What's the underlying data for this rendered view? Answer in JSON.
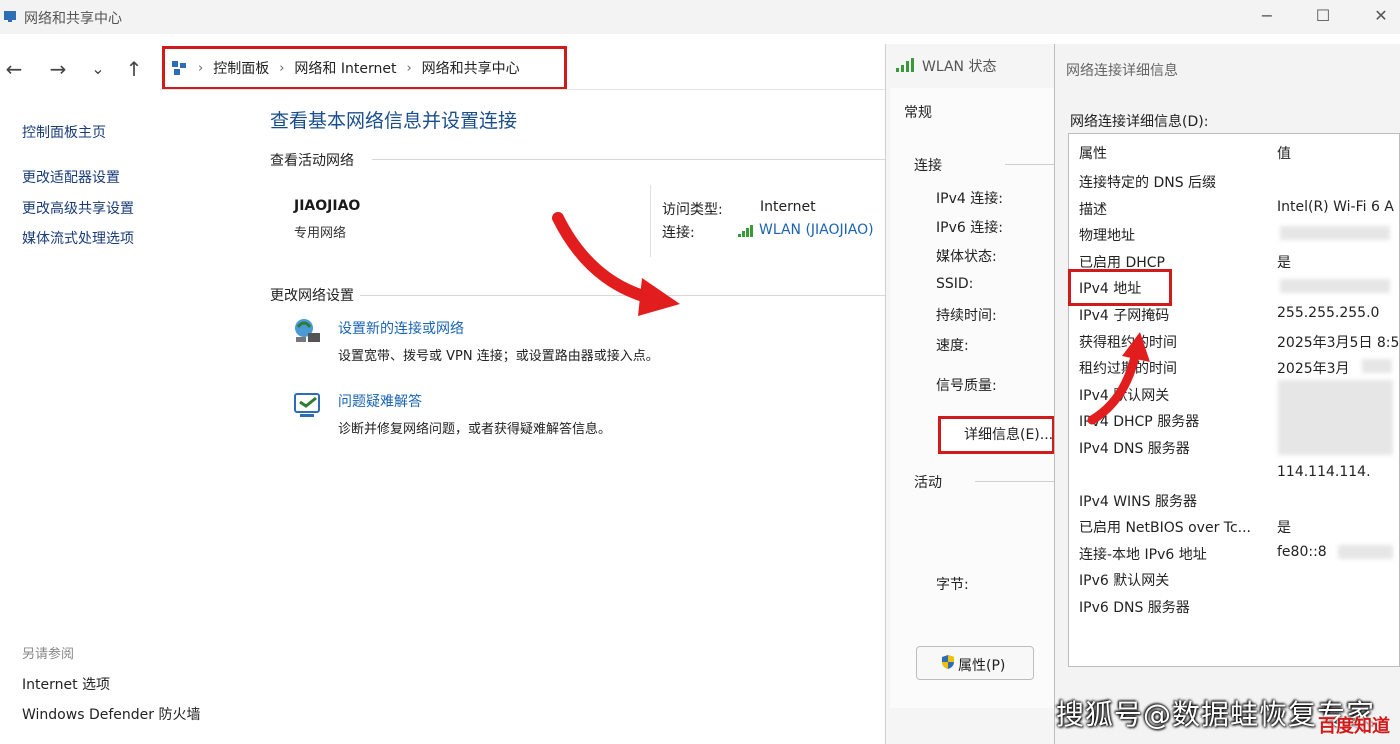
{
  "window": {
    "title": "网络和共享中心",
    "controls": {
      "minimize": "−",
      "maximize": "☐",
      "close": "✕"
    }
  },
  "nav": {
    "back": "←",
    "forward": "→",
    "history": "⌄",
    "up": "↑"
  },
  "breadcrumb": {
    "items": [
      "控制面板",
      "网络和 Internet",
      "网络和共享中心"
    ],
    "separator": "›"
  },
  "sidebar": {
    "home": "控制面板主页",
    "links": [
      "更改适配器设置",
      "更改高级共享设置",
      "媒体流式处理选项"
    ],
    "see_also": "另请参阅",
    "see_also_links": [
      "Internet 选项",
      "Windows Defender 防火墙"
    ]
  },
  "main": {
    "heading": "查看基本网络信息并设置连接",
    "active_networks": "查看活动网络",
    "network_name": "JIAOJIAO",
    "network_type": "专用网络",
    "access_type_label": "访问类型:",
    "access_type_value": "Internet",
    "connection_label": "连接:",
    "connection_value": "WLAN (JIAOJIAO)",
    "change_settings": "更改网络设置",
    "tasks": [
      {
        "title": "设置新的连接或网络",
        "desc": "设置宽带、拨号或 VPN 连接；或设置路由器或接入点。",
        "icon": "network-setup-icon"
      },
      {
        "title": "问题疑难解答",
        "desc": "诊断并修复网络问题，或者获得疑难解答信息。",
        "icon": "troubleshoot-icon"
      }
    ]
  },
  "wlan_dialog": {
    "title": "WLAN 状态",
    "tab": "常规",
    "connection_section": "连接",
    "fields": [
      "IPv4 连接:",
      "IPv6 连接:",
      "媒体状态:",
      "SSID:",
      "持续时间:",
      "速度:"
    ],
    "signal": "信号质量:",
    "details_button": "详细信息(E)...",
    "activity_section": "活动",
    "bytes": "字节:",
    "properties_button": "属性(P)"
  },
  "details_dialog": {
    "title": "网络连接详细信息",
    "label": "网络连接详细信息(D):",
    "header": {
      "property": "属性",
      "value": "值"
    },
    "rows": [
      {
        "property": "连接特定的 DNS 后缀",
        "value": ""
      },
      {
        "property": "描述",
        "value": "Intel(R) Wi-Fi 6 A"
      },
      {
        "property": "物理地址",
        "value": ""
      },
      {
        "property": "已启用 DHCP",
        "value": "是"
      },
      {
        "property": "IPv4 地址",
        "value": ""
      },
      {
        "property": "IPv4 子网掩码",
        "value": "255.255.255.0"
      },
      {
        "property": "获得租约的时间",
        "value": "2025年3月5日 8:5"
      },
      {
        "property": "租约过期的时间",
        "value": "2025年3月"
      },
      {
        "property": "IPv4 默认网关",
        "value": ""
      },
      {
        "property": "IPv4 DHCP 服务器",
        "value": ""
      },
      {
        "property": "IPv4 DNS 服务器",
        "value": ""
      },
      {
        "property": "",
        "value": "114.114.114."
      },
      {
        "property": "IPv4 WINS 服务器",
        "value": ""
      },
      {
        "property": "已启用 NetBIOS over Tc...",
        "value": "是"
      },
      {
        "property": "连接-本地 IPv6 地址",
        "value": "fe80::8"
      },
      {
        "property": "IPv6 默认网关",
        "value": ""
      },
      {
        "property": "IPv6 DNS 服务器",
        "value": ""
      }
    ]
  },
  "overlay": {
    "watermark": "搜狐号@数据蛙恢复专家",
    "baidu": "百度知道"
  },
  "colors": {
    "highlight": "#d11b1b",
    "link": "#1b64b3",
    "heading": "#1b4f8c"
  }
}
